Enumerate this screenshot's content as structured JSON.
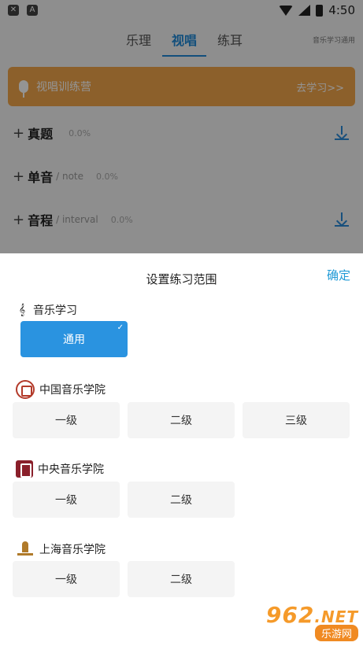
{
  "status_bar": {
    "time": "4:50",
    "left_icons": [
      "close-icon",
      "a-icon"
    ]
  },
  "tabs": [
    {
      "label": "乐理",
      "active": false
    },
    {
      "label": "视唱",
      "active": true
    },
    {
      "label": "练耳",
      "active": false
    }
  ],
  "tabs_right": "音乐学习通用",
  "banner": {
    "title": "视唱训练营",
    "link": "去学习>>"
  },
  "rows": [
    {
      "title": "真题",
      "sub": "",
      "pct": "0.0%",
      "download": true
    },
    {
      "title": "单音",
      "sub": "/ note",
      "pct": "0.0%",
      "download": false
    },
    {
      "title": "音程",
      "sub": "/ interval",
      "pct": "0.0%",
      "download": true
    }
  ],
  "sheet": {
    "title": "设置练习范围",
    "confirm": "确定",
    "sections": [
      {
        "name": "音乐学习",
        "logo": "treble-clef-icon",
        "options": [
          {
            "label": "通用",
            "selected": true
          }
        ]
      },
      {
        "name": "中国音乐学院",
        "logo": "ccom-logo-icon",
        "options": [
          {
            "label": "一级"
          },
          {
            "label": "二级"
          },
          {
            "label": "三级"
          }
        ]
      },
      {
        "name": "中央音乐学院",
        "logo": "ccm-logo-icon",
        "options": [
          {
            "label": "一级"
          },
          {
            "label": "二级"
          }
        ]
      },
      {
        "name": "上海音乐学院",
        "logo": "shcm-logo-icon",
        "options": [
          {
            "label": "一级"
          },
          {
            "label": "二级"
          }
        ]
      }
    ]
  },
  "watermark": {
    "brand": "962",
    "tld": ".NET",
    "sub": "乐游网"
  },
  "colors": {
    "accent": "#1f88d6",
    "selected": "#2a93e0",
    "banner": "#f2a54a",
    "confirm": "#1f9ad6"
  }
}
